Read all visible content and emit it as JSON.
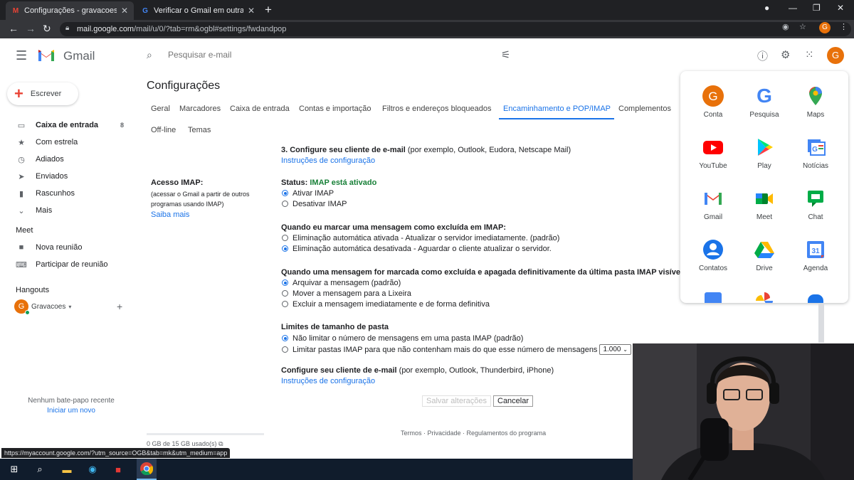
{
  "browser": {
    "tabs": [
      {
        "title": "Configurações - gravacoesphsbr...",
        "active": true
      },
      {
        "title": "Verificar o Gmail em outras plata...",
        "active": false
      }
    ],
    "url_host": "mail.google.com",
    "url_path": "/mail/u/0/?tab=rm&ogbl#settings/fwdandpop",
    "profile_letter": "G"
  },
  "header": {
    "product": "Gmail",
    "search_placeholder": "Pesquisar e-mail",
    "avatar_letter": "G"
  },
  "compose_label": "Escrever",
  "nav": {
    "items": [
      {
        "label": "Caixa de entrada",
        "count": "8",
        "icon": "inbox-icon"
      },
      {
        "label": "Com estrela",
        "count": "",
        "icon": "star-icon"
      },
      {
        "label": "Adiados",
        "count": "",
        "icon": "clock-icon"
      },
      {
        "label": "Enviados",
        "count": "",
        "icon": "send-icon"
      },
      {
        "label": "Rascunhos",
        "count": "",
        "icon": "draft-icon"
      },
      {
        "label": "Mais",
        "count": "",
        "icon": "chevron-down-icon"
      }
    ],
    "meet_title": "Meet",
    "meet_items": [
      {
        "label": "Nova reunião",
        "icon": "video-icon"
      },
      {
        "label": "Participar de reunião",
        "icon": "keyboard-icon"
      }
    ],
    "hangouts_title": "Hangouts",
    "hangouts_user": "Gravacoes",
    "hangouts_user_letter": "G",
    "no_chat": "Nenhum bate-papo recente",
    "start_new": "Iniciar um novo"
  },
  "settings": {
    "title": "Configurações",
    "tabs": [
      "Geral",
      "Marcadores",
      "Caixa de entrada",
      "Contas e importação",
      "Filtros e endereços bloqueados",
      "Encaminhamento e POP/IMAP",
      "Complementos",
      "Off-line",
      "Temas"
    ],
    "active_tab": "Encaminhamento e POP/IMAP",
    "step3_title": "3. Configure seu cliente de e-mail",
    "step3_rest": " (por exemplo, Outlook, Eudora, Netscape Mail)",
    "config_instructions": "Instruções de configuração",
    "imap_label": "Acesso IMAP:",
    "imap_desc": "(acessar o Gmail a partir de outros programas usando IMAP)",
    "imap_more": "Saiba mais",
    "status_label": "Status: ",
    "status_value": "IMAP está ativado",
    "enable": "Ativar IMAP",
    "disable": "Desativar IMAP",
    "delete_title": "Quando eu marcar uma mensagem como excluída em IMAP:",
    "delete_opts": [
      "Eliminação automática ativada - Atualizar o servidor imediatamente. (padrão)",
      "Eliminação automática desativada - Aguardar o cliente atualizar o servidor."
    ],
    "expunge_title": "Quando uma mensagem for marcada como excluída e apagada definitivamente da última pasta IMAP visível:",
    "expunge_opts": [
      "Arquivar a mensagem (padrão)",
      "Mover a mensagem para a Lixeira",
      "Excluir a mensagem imediatamente e de forma definitiva"
    ],
    "limit_title": "Limites de tamanho de pasta",
    "limit_opts": [
      "Não limitar o número de mensagens em uma pasta IMAP (padrão)",
      "Limitar pastas IMAP para que não contenham mais do que esse número de mensagens"
    ],
    "limit_value": "1.000",
    "client_title": "Configure seu cliente de e-mail",
    "client_rest": " (por exemplo, Outlook, Thunderbird, iPhone)",
    "client_instructions": "Instruções de configuração",
    "save": "Salvar alterações",
    "cancel": "Cancelar",
    "footer": "Termos · Privacidade · Regulamentos do programa",
    "storage": "0 GB de 15 GB usado(s)"
  },
  "apps": [
    {
      "label": "Conta"
    },
    {
      "label": "Pesquisa"
    },
    {
      "label": "Maps"
    },
    {
      "label": "YouTube"
    },
    {
      "label": "Play"
    },
    {
      "label": "Notícias"
    },
    {
      "label": "Gmail"
    },
    {
      "label": "Meet"
    },
    {
      "label": "Chat"
    },
    {
      "label": "Contatos"
    },
    {
      "label": "Drive"
    },
    {
      "label": "Agenda"
    }
  ],
  "status_bar_url": "https://myaccount.google.com/?utm_source=OGB&tab=mk&utm_medium=app",
  "colors": {
    "accent": "#1a73e8",
    "avatar": "#e8710a",
    "status_green": "#188038"
  }
}
